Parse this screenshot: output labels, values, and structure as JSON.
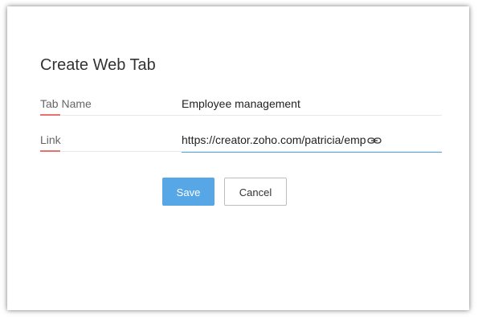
{
  "dialog": {
    "title": "Create Web Tab",
    "fields": {
      "tab_name": {
        "label": "Tab Name",
        "value": "Employee management"
      },
      "link": {
        "label": "Link",
        "value": "https://creator.zoho.com/patricia/emp",
        "icon": "link-icon"
      }
    },
    "buttons": {
      "save": "Save",
      "cancel": "Cancel"
    }
  },
  "colors": {
    "primary": "#57a6e6",
    "label_underline": "#e8706f",
    "active_field_border": "#58a9de"
  }
}
